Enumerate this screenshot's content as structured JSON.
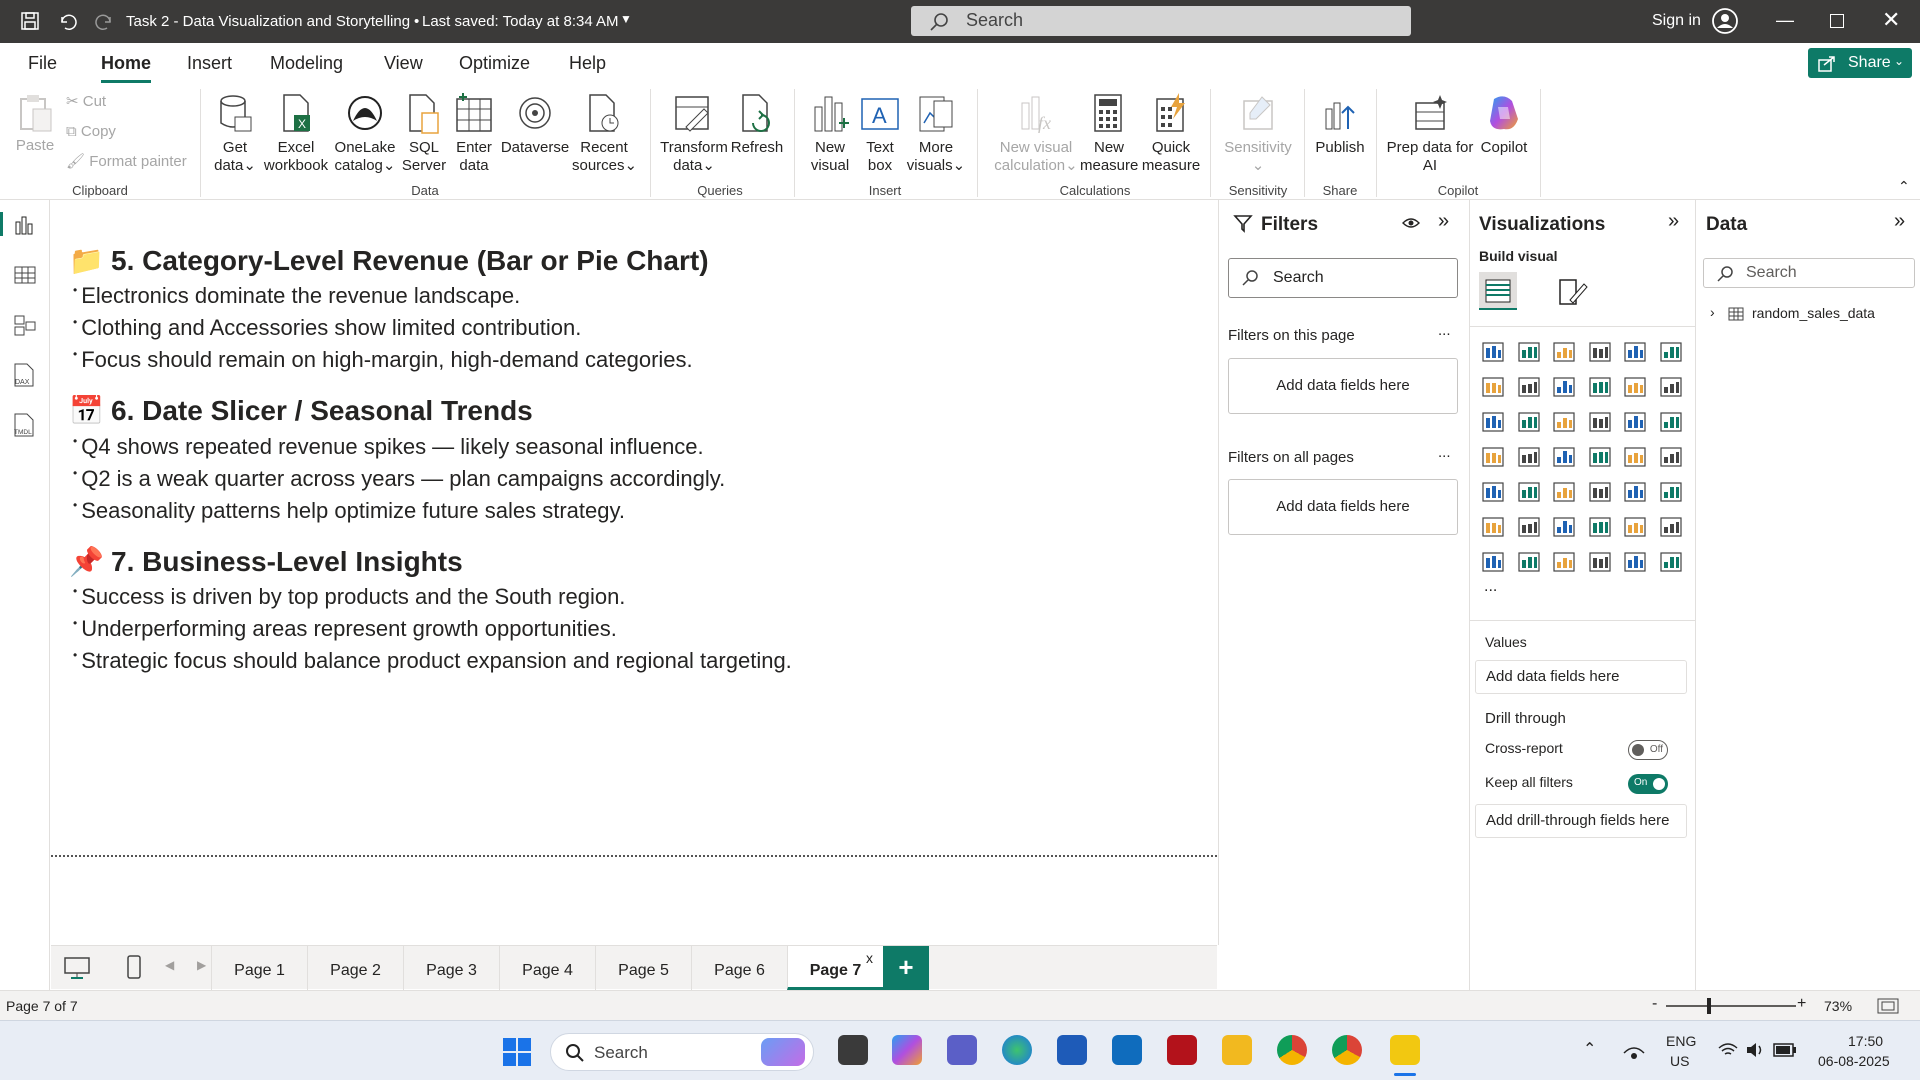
{
  "title_bar": {
    "doc_title": "Task 2 - Data Visualization and Storytelling",
    "saved": "Last saved: Today at 8:34 AM",
    "search_placeholder": "Search",
    "sign_in": "Sign in"
  },
  "menu": {
    "items": [
      "File",
      "Home",
      "Insert",
      "Modeling",
      "View",
      "Optimize",
      "Help"
    ],
    "active": "Home",
    "share_label": "Share"
  },
  "ribbon": {
    "clipboard": {
      "paste": "Paste",
      "cut": "Cut",
      "copy": "Copy",
      "format_painter": "Format painter",
      "group": "Clipboard"
    },
    "data": {
      "get_data": "Get",
      "get_data2": "data",
      "excel": "Excel",
      "excel2": "workbook",
      "onelake": "OneLake",
      "onelake2": "catalog",
      "sql": "SQL",
      "sql2": "Server",
      "enter": "Enter",
      "enter2": "data",
      "dataverse": "Dataverse",
      "recent": "Recent",
      "recent2": "sources",
      "group": "Data"
    },
    "queries": {
      "transform": "Transform",
      "transform2": "data",
      "refresh": "Refresh",
      "group": "Queries"
    },
    "insert": {
      "new_visual": "New",
      "new_visual2": "visual",
      "text_box": "Text",
      "text_box2": "box",
      "more_visuals": "More",
      "more_visuals2": "visuals",
      "group": "Insert"
    },
    "calculations": {
      "new_visual_calc": "New visual",
      "new_visual_calc2": "calculation",
      "new_measure": "New",
      "new_measure2": "measure",
      "quick_measure": "Quick",
      "quick_measure2": "measure",
      "group": "Calculations"
    },
    "sensitivity": {
      "label": "Sensitivity",
      "group": "Sensitivity"
    },
    "share": {
      "publish": "Publish",
      "group": "Share"
    },
    "copilot": {
      "prep": "Prep data for",
      "prep2": "AI",
      "copilot": "Copilot",
      "group": "Copilot"
    }
  },
  "canvas": {
    "sections": [
      {
        "icon": "📁",
        "heading": "5. Category-Level Revenue (Bar or Pie Chart)",
        "bullets": [
          "Electronics dominate the revenue landscape.",
          "Clothing and Accessories show limited contribution.",
          "Focus should remain on high-margin, high-demand categories."
        ]
      },
      {
        "icon": "📅",
        "heading": "6. Date Slicer / Seasonal Trends",
        "bullets": [
          "Q4 shows repeated revenue spikes — likely seasonal influence.",
          "Q2 is a weak quarter across years — plan campaigns accordingly.",
          "Seasonality patterns help optimize future sales strategy."
        ]
      },
      {
        "icon": "📌",
        "heading": "7. Business-Level Insights",
        "bullets": [
          "Success is driven by top products and the South region.",
          "Underperforming areas represent growth opportunities.",
          "Strategic focus should balance product expansion and regional targeting."
        ]
      }
    ]
  },
  "filters": {
    "title": "Filters",
    "search_placeholder": "Search",
    "on_this_page": "Filters on this page",
    "on_all_pages": "Filters on all pages",
    "add_fields": "Add data fields here",
    "more": "..."
  },
  "visualizations": {
    "title": "Visualizations",
    "build_visual": "Build visual",
    "more": "...",
    "values_label": "Values",
    "values_add": "Add data fields here",
    "drill_through": "Drill through",
    "cross_report": "Cross-report",
    "cross_report_state": "Off",
    "keep_all_filters": "Keep all filters",
    "keep_all_filters_state": "On",
    "drill_add": "Add drill-through fields here"
  },
  "data_pane": {
    "title": "Data",
    "search_placeholder": "Search",
    "tables": [
      "random_sales_data"
    ]
  },
  "pages": {
    "tabs": [
      "Page 1",
      "Page 2",
      "Page 3",
      "Page 4",
      "Page 5",
      "Page 6",
      "Page 7"
    ],
    "active": "Page 7",
    "close": "x",
    "add": "+"
  },
  "status": {
    "page_info": "Page 7 of 7",
    "zoom": "73%",
    "zoom_minus": "-",
    "zoom_plus": "+"
  },
  "taskbar": {
    "search_placeholder": "Search",
    "lang1": "ENG",
    "lang2": "US",
    "time": "17:50",
    "date": "06-08-2025"
  },
  "colors": {
    "accent": "#0e7a67",
    "titlebar": "#3b3a39",
    "powerbi_yellow": "#f2c811"
  }
}
